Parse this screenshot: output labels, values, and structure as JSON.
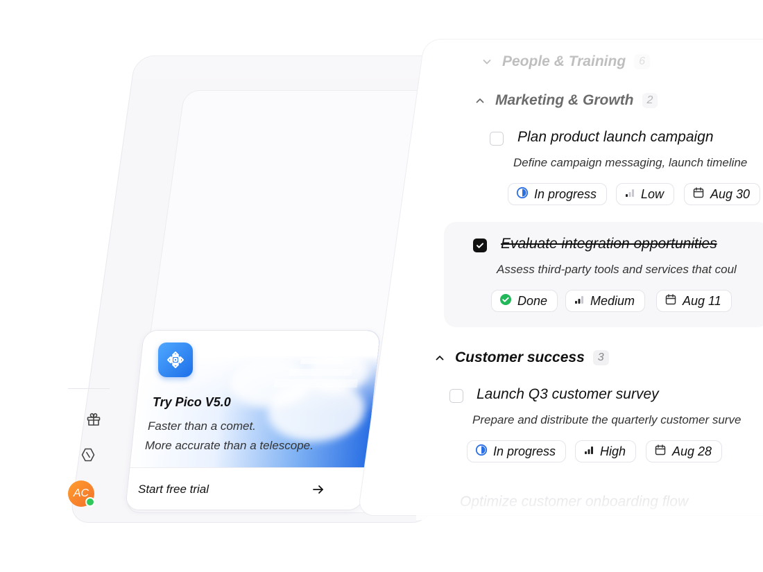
{
  "sidebar": {
    "avatar_initials": "AC",
    "icons": [
      "gift-icon",
      "hexagon-icon"
    ]
  },
  "promo": {
    "title": "Try Pico V5.0",
    "line1": "Faster than a comet.",
    "line2": "More accurate than a telescope.",
    "cta_label": "Start free trial"
  },
  "groups": [
    {
      "title": "People & Training",
      "count": "6"
    },
    {
      "title": "Marketing & Growth",
      "count": "2"
    },
    {
      "title": "Customer success",
      "count": "3"
    }
  ],
  "tasks": [
    {
      "title": "Plan product launch campaign",
      "description": "Define campaign messaging, launch timeline",
      "status": "In progress",
      "priority": "Low",
      "due": "Aug 30"
    },
    {
      "title": "Evaluate integration opportunities",
      "description": "Assess third-party tools and services that coul",
      "status": "Done",
      "priority": "Medium",
      "due": "Aug 11"
    },
    {
      "title": "Launch Q3 customer survey",
      "description": "Prepare and distribute the quarterly customer surve",
      "status": "In progress",
      "priority": "High",
      "due": "Aug 28"
    },
    {
      "title": "Optimize customer onboarding flow"
    }
  ],
  "colors": {
    "accent_blue": "#2a6fe4",
    "done_green": "#22b85a",
    "avatar_orange": "#f2802a"
  }
}
